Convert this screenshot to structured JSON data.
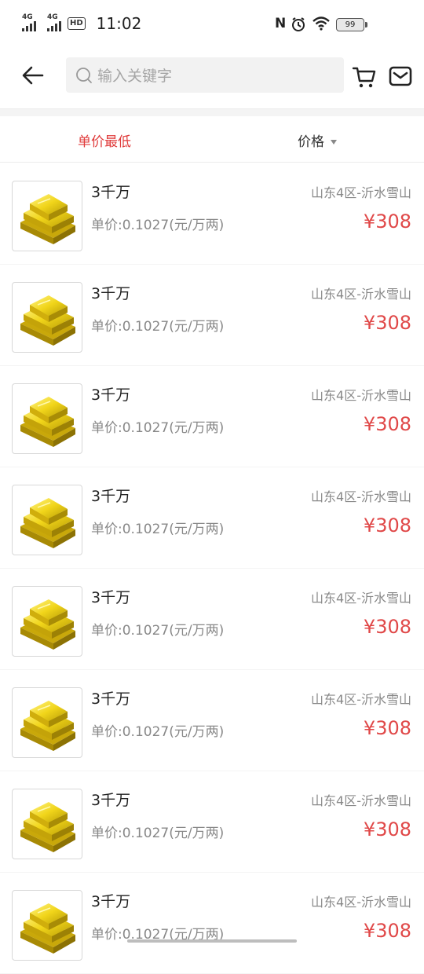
{
  "status_bar": {
    "signal1": "4G",
    "signal2": "4G",
    "hd": "HD",
    "time": "11:02",
    "battery": "99"
  },
  "search": {
    "placeholder": "输入关键字"
  },
  "sort": {
    "lowest_unit_price": "单价最低",
    "price": "价格"
  },
  "colors": {
    "accent_red": "#e04848",
    "tab_active": "#e03c3c"
  },
  "items": [
    {
      "title": "3千万",
      "unit_price": "单价:0.1027(元/万两)",
      "server": "山东4区-沂水雪山",
      "price": "¥308",
      "icon": "gold-bars-icon"
    },
    {
      "title": "3千万",
      "unit_price": "单价:0.1027(元/万两)",
      "server": "山东4区-沂水雪山",
      "price": "¥308",
      "icon": "gold-bars-icon"
    },
    {
      "title": "3千万",
      "unit_price": "单价:0.1027(元/万两)",
      "server": "山东4区-沂水雪山",
      "price": "¥308",
      "icon": "gold-bars-icon"
    },
    {
      "title": "3千万",
      "unit_price": "单价:0.1027(元/万两)",
      "server": "山东4区-沂水雪山",
      "price": "¥308",
      "icon": "gold-bars-icon"
    },
    {
      "title": "3千万",
      "unit_price": "单价:0.1027(元/万两)",
      "server": "山东4区-沂水雪山",
      "price": "¥308",
      "icon": "gold-bars-icon"
    },
    {
      "title": "3千万",
      "unit_price": "单价:0.1027(元/万两)",
      "server": "山东4区-沂水雪山",
      "price": "¥308",
      "icon": "gold-bars-icon"
    },
    {
      "title": "3千万",
      "unit_price": "单价:0.1027(元/万两)",
      "server": "山东4区-沂水雪山",
      "price": "¥308",
      "icon": "gold-bars-icon"
    },
    {
      "title": "3千万",
      "unit_price": "单价:0.1027(元/万两)",
      "server": "山东4区-沂水雪山",
      "price": "¥308",
      "icon": "gold-bars-icon"
    }
  ]
}
